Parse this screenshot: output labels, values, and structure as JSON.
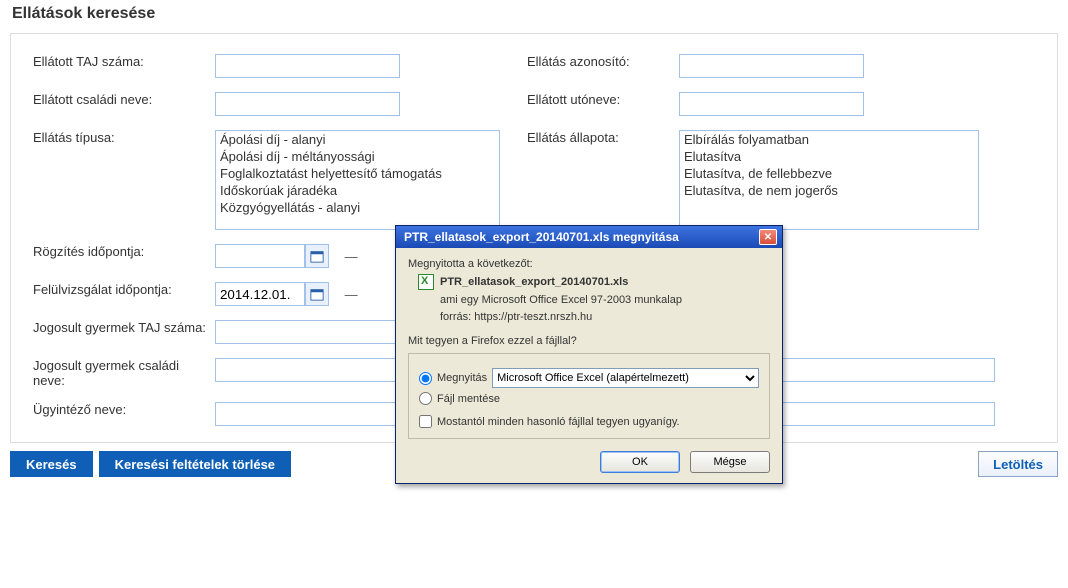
{
  "page": {
    "title": "Ellátások keresése"
  },
  "labels": {
    "taj": "Ellátott TAJ száma:",
    "csaladi": "Ellátott családi neve:",
    "tipus": "Ellátás típusa:",
    "rogzites": "Rögzítés időpontja:",
    "felulvizs": "Felülvizsgálat időpontja:",
    "gyerek_taj": "Jogosult gyermek TAJ száma:",
    "gyerek_csal": "Jogosult gyermek családi neve:",
    "ugyintezo": "Ügyintéző neve:",
    "azonosito": "Ellátás azonosító:",
    "utoneve": "Ellátott utóneve:",
    "allapot": "Ellátás állapota:"
  },
  "tipus_options": [
    "Ápolási díj - alanyi",
    "Ápolási díj - méltányossági",
    "Foglalkoztatást helyettesítő támogatás",
    "Időskorúak járadéka",
    "Közgyógyellátás - alanyi"
  ],
  "allapot_options": [
    "Elbírálás folyamatban",
    "Elutasítva",
    "Elutasítva, de fellebbezve",
    "Elutasítva, de nem jogerős"
  ],
  "felulvizs_from": "2014.12.01.",
  "buttons": {
    "search": "Keresés",
    "clear": "Keresési feltételek törlése",
    "download": "Letöltés"
  },
  "dialog": {
    "title": "PTR_ellatasok_export_20140701.xls megnyitása",
    "opened": "Megnyitotta a következőt:",
    "filename": "PTR_ellatasok_export_20140701.xls",
    "which_is_lbl": "ami egy",
    "which_is_val": "Microsoft Office Excel 97-2003 munkalap",
    "source_lbl": "forrás:",
    "source_val": "https://ptr-teszt.nrszh.hu",
    "question": "Mit tegyen a Firefox ezzel a fájllal?",
    "open": "Megnyitás",
    "open_with": "Microsoft Office Excel (alapértelmezett)",
    "save": "Fájl mentése",
    "remember": "Mostantól minden hasonló fájllal tegyen ugyanígy.",
    "ok": "OK",
    "cancel": "Mégse"
  }
}
